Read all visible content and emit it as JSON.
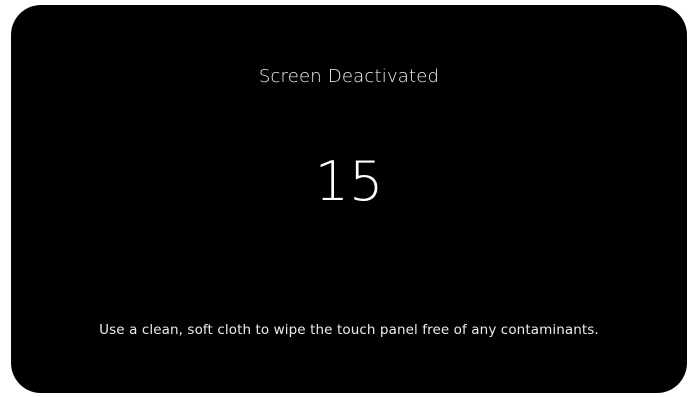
{
  "screen": {
    "title": "Screen Deactivated",
    "countdown": "15",
    "instructions": "Use a clean, soft cloth to wipe the touch panel free of any contaminants."
  },
  "colors": {
    "background": "#000000",
    "text": "#ffffff"
  }
}
